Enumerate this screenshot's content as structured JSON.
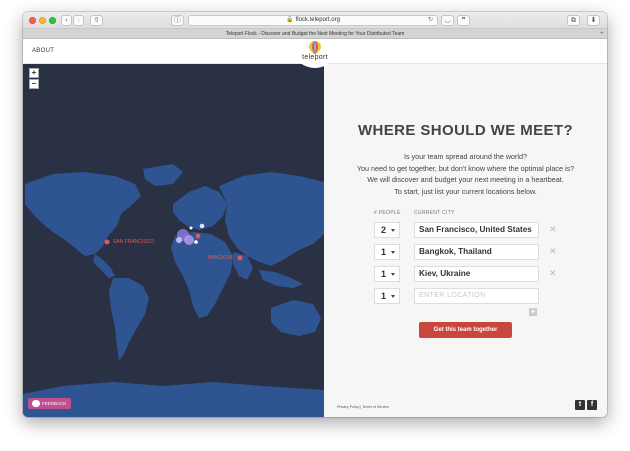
{
  "browser": {
    "url": "flock.teleport.org",
    "tab_title": "Teleport Flock - Discover and Budget the Next Meeting for Your Distributed Team"
  },
  "header": {
    "about": "ABOUT",
    "logo_text": "teleport"
  },
  "map": {
    "zoom_in": "+",
    "zoom_out": "−",
    "labels": {
      "sf": "SAN FRANCISCO",
      "bkk": "BANGKOK"
    },
    "feedback": "FEEDBACK",
    "colors": {
      "ocean": "#2b3144",
      "land": "#2e5591",
      "marker": "#e05757",
      "cluster": "#b399f0"
    }
  },
  "panel": {
    "headline": "WHERE SHOULD WE MEET?",
    "intro": [
      "Is your team spread around the world?",
      "You need to get together, but don't know where the optimal place is?",
      "We will discover and budget your next meeting in a heartbeat.",
      "To start, just list your current locations below."
    ],
    "col_people": "# PEOPLE",
    "col_city": "CURRENT CITY",
    "rows": [
      {
        "count": "2",
        "city": "San Francisco, United States"
      },
      {
        "count": "1",
        "city": "Bangkok, Thailand"
      },
      {
        "count": "1",
        "city": "Kiev, Ukraine"
      }
    ],
    "empty_row": {
      "count": "1",
      "placeholder": "ENTER LOCATION"
    },
    "add": "+",
    "cta": "Get this team together",
    "footer": "Privacy Policy  |  Terms of Service",
    "accent": "#c8463c"
  }
}
